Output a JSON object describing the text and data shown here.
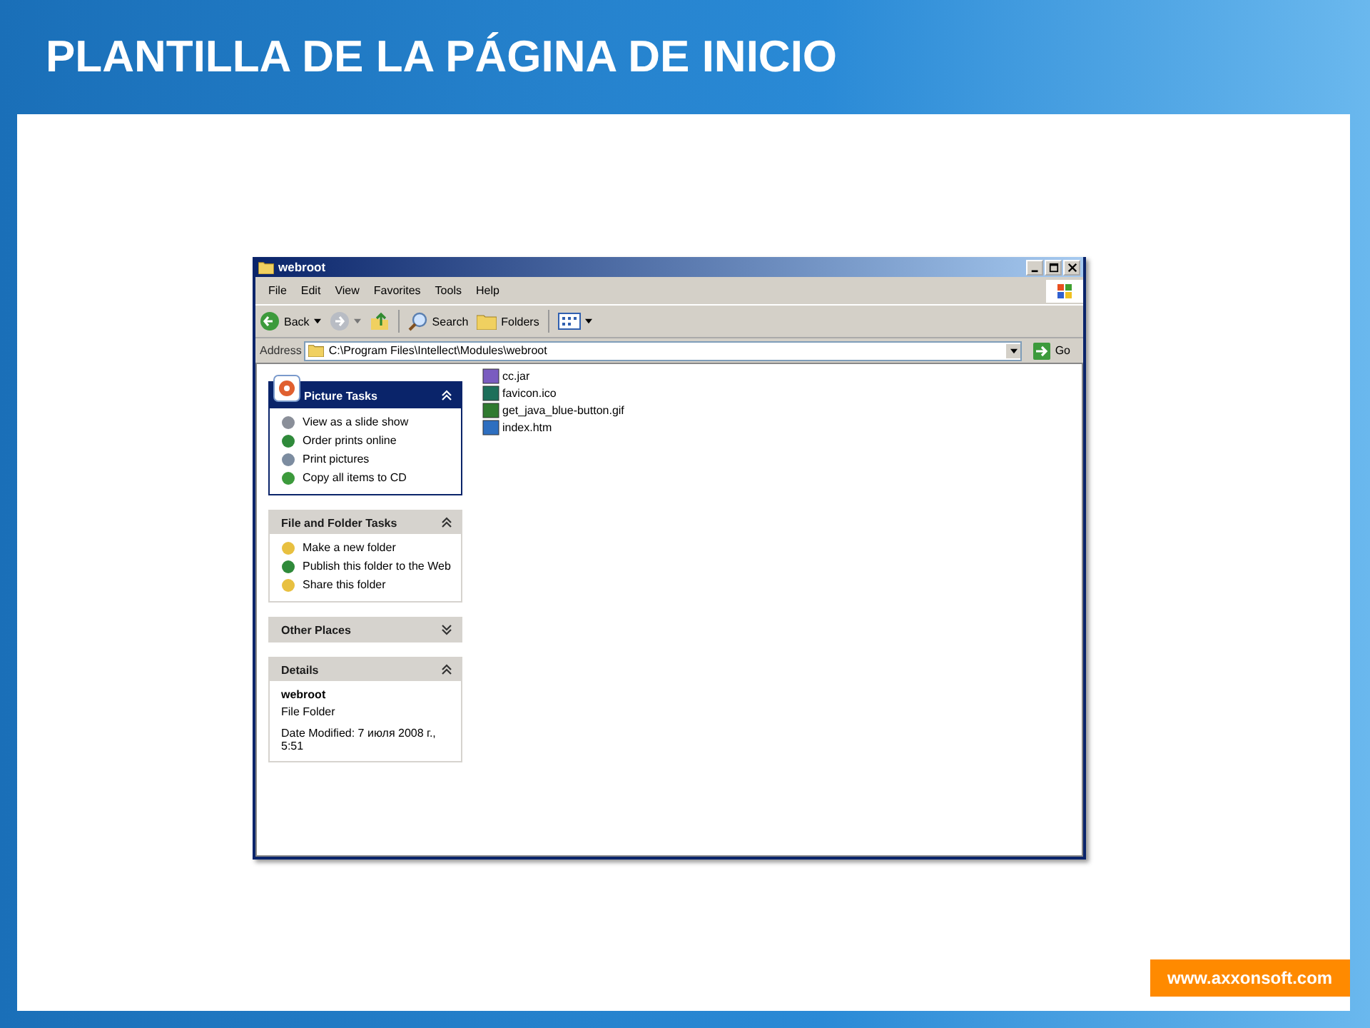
{
  "slide": {
    "title": "PLANTILLA DE LA PÁGINA DE INICIO",
    "footer_link": "www.axxonsoft.com"
  },
  "window": {
    "title": "webroot"
  },
  "menu": [
    "File",
    "Edit",
    "View",
    "Favorites",
    "Tools",
    "Help"
  ],
  "toolbar": {
    "back": "Back",
    "search": "Search",
    "folders": "Folders"
  },
  "address": {
    "label": "Address",
    "value": "C:\\Program Files\\Intellect\\Modules\\webroot",
    "go": "Go"
  },
  "panels": [
    {
      "kind": "picture_tasks",
      "title": "Picture Tasks",
      "expanded": true,
      "items": [
        "View as a slide show",
        "Order prints online",
        "Print pictures",
        "Copy all items to CD"
      ]
    },
    {
      "kind": "tasks",
      "title": "File and Folder Tasks",
      "expanded": true,
      "items": [
        "Make a new folder",
        "Publish this folder to the Web",
        "Share this folder"
      ]
    },
    {
      "kind": "places",
      "title": "Other Places",
      "expanded": false
    },
    {
      "kind": "details",
      "title": "Details",
      "expanded": true,
      "name": "webroot",
      "type": "File Folder",
      "modified": "Date Modified: 7 июля 2008 г., 5:51"
    }
  ],
  "files": [
    "cc.jar",
    "favicon.ico",
    "get_java_blue-button.gif",
    "index.htm"
  ]
}
